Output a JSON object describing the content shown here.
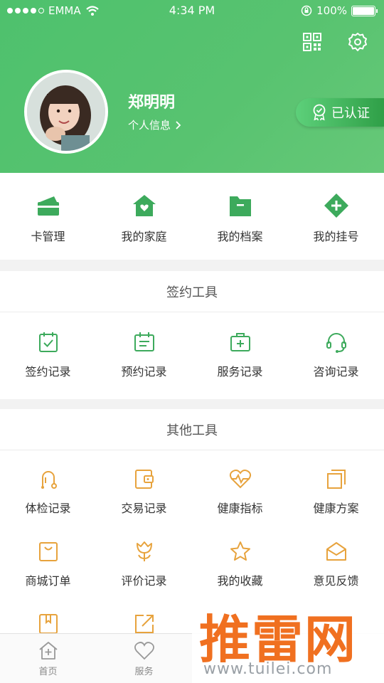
{
  "status": {
    "carrier": "EMMA",
    "time": "4:34 PM",
    "battery": "100%"
  },
  "colors": {
    "green": "#4ec16d",
    "icon_green": "#3daa5c",
    "icon_orange": "#e7a33d",
    "watermark": "#f07020"
  },
  "profile": {
    "name": "郑明明",
    "link_label": "个人信息",
    "verified_label": "已认证"
  },
  "header_icons": [
    "qrcode-icon",
    "settings-icon"
  ],
  "quick_actions": [
    {
      "label": "卡管理",
      "icon": "card-icon"
    },
    {
      "label": "我的家庭",
      "icon": "home-icon"
    },
    {
      "label": "我的档案",
      "icon": "folder-icon"
    },
    {
      "label": "我的挂号",
      "icon": "plus-diamond-icon"
    }
  ],
  "sign_tools": {
    "title": "签约工具",
    "items": [
      {
        "label": "签约记录",
        "icon": "calendar-check-icon"
      },
      {
        "label": "预约记录",
        "icon": "calendar-list-icon"
      },
      {
        "label": "服务记录",
        "icon": "medical-kit-icon"
      },
      {
        "label": "咨询记录",
        "icon": "headset-icon"
      }
    ]
  },
  "other_tools": {
    "title": "其他工具",
    "items": [
      {
        "label": "体检记录",
        "icon": "stethoscope-icon"
      },
      {
        "label": "交易记录",
        "icon": "wallet-icon"
      },
      {
        "label": "健康指标",
        "icon": "heart-pulse-icon"
      },
      {
        "label": "健康方案",
        "icon": "copy-icon"
      },
      {
        "label": "商城订单",
        "icon": "shopping-bag-icon"
      },
      {
        "label": "评价记录",
        "icon": "flower-icon"
      },
      {
        "label": "我的收藏",
        "icon": "star-icon"
      },
      {
        "label": "意见反馈",
        "icon": "mail-icon"
      },
      {
        "label": "",
        "icon": "book-icon"
      },
      {
        "label": "",
        "icon": "share-icon"
      }
    ]
  },
  "tabbar": [
    {
      "label": "首页",
      "icon": "home-outline-icon"
    },
    {
      "label": "服务",
      "icon": "heart-outline-icon"
    }
  ],
  "watermark": {
    "text": "推雷网",
    "url": "www.tuilei.com"
  }
}
